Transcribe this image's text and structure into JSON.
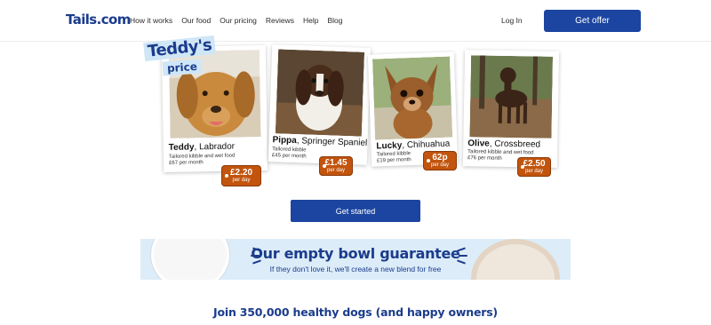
{
  "brand": {
    "logo": "Tails.com",
    "accent": "#1b45a0",
    "tag_color": "#c2540d"
  },
  "nav": {
    "items": [
      "How it works",
      "Our food",
      "Our pricing",
      "Reviews",
      "Help",
      "Blog"
    ],
    "login": "Log In",
    "cta": "Get offer"
  },
  "badge": {
    "title": "Teddy's",
    "subtitle": "price"
  },
  "dogs": [
    {
      "name": "Teddy",
      "breed": ", Labrador",
      "food": "Tailored kibble and wet food",
      "month": "£67 per month",
      "price": "£2.20",
      "per": "per day"
    },
    {
      "name": "Pippa",
      "breed": ", Springer Spaniel",
      "food": "Tailored kibble",
      "month": "£45 per month",
      "price": "£1.45",
      "per": "per day"
    },
    {
      "name": "Lucky",
      "breed": ", Chihuahua",
      "food": "Tailored kibble",
      "month": "£19 per month",
      "price": "62p",
      "per": "per day"
    },
    {
      "name": "Olive",
      "breed": ", Crossbreed",
      "food": "Tailored kibble and wet food",
      "month": "£76 per month",
      "price": "£2.50",
      "per": "per day"
    }
  ],
  "cta_start": "Get started",
  "guarantee": {
    "title": "Our empty bowl guarantee",
    "subtitle": "If they don't love it, we'll create a new blend for free"
  },
  "join": "Join 350,000 healthy dogs (and happy owners)"
}
